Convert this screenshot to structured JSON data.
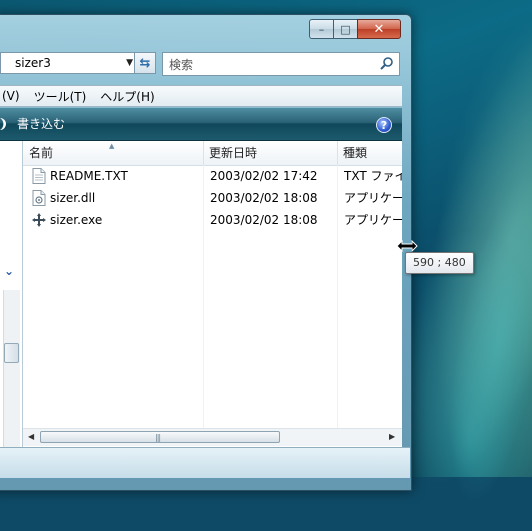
{
  "window": {
    "caption_buttons": {
      "minimize": "–",
      "maximize": "□",
      "close": "✕"
    }
  },
  "address_bar": {
    "path": "sizer3"
  },
  "search": {
    "placeholder": "検索"
  },
  "menu": {
    "items": [
      "(V)",
      "ツール(T)",
      "ヘルプ(H)"
    ]
  },
  "command_bar": {
    "burn_label": "書き込む",
    "help_symbol": "?"
  },
  "file_list": {
    "columns": [
      "名前",
      "更新日時",
      "種類"
    ],
    "rows": [
      {
        "name": "README.TXT",
        "modified": "2003/02/02 17:42",
        "type": "TXT ファイル",
        "icon": "text-file-icon"
      },
      {
        "name": "sizer.dll",
        "modified": "2003/02/02 18:08",
        "type": "アプリケーション拡張",
        "icon": "dll-file-icon"
      },
      {
        "name": "sizer.exe",
        "modified": "2003/02/02 18:08",
        "type": "アプリケーション",
        "icon": "exe-file-icon"
      }
    ]
  },
  "resize_tooltip": {
    "text": "590 ; 480"
  },
  "colors": {
    "command_bar": "#1d5a6d",
    "close_button": "#c94a2f",
    "desktop": "#0c6b86"
  }
}
